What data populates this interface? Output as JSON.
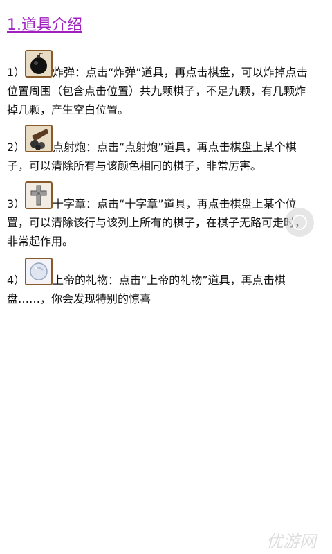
{
  "page": {
    "title": "1.道具介绍"
  },
  "items": [
    {
      "number": "1）",
      "icon": "bomb-icon",
      "text_line1": "炸弹：点击“炸弹”道具，再点击棋盘，可以炸掉点击",
      "text_rest": "位置周围（包含点击位置）共九颗棋子，不足九颗，有几颗炸掉几颗，产生空白位置。"
    },
    {
      "number": "2）",
      "icon": "cannon-icon",
      "text_line1": "点射炮：点击“点射炮”道具，再点击棋盘上某个棋",
      "text_rest": "子，可以清除所有与该颜色相同的棋子，非常厉害。"
    },
    {
      "number": "3）",
      "icon": "cross-icon",
      "text_line1": "十字章：点击“十字章”道具，再点击棋盘上某个位",
      "text_rest": "置，可以清除该行与该列上所有的棋子，在棋子无路可走时，非常起作用。"
    },
    {
      "number": "4）",
      "icon": "gift-orb-icon",
      "text_line1": "上帝的礼物：点击“上帝的礼物”道具，再点击棋",
      "text_rest": "盘……，你会发现特别的惊喜"
    }
  ],
  "watermark": {
    "text": "优游网"
  },
  "colors": {
    "title": "#a020c0",
    "icon_border": "#8a5a2a"
  }
}
